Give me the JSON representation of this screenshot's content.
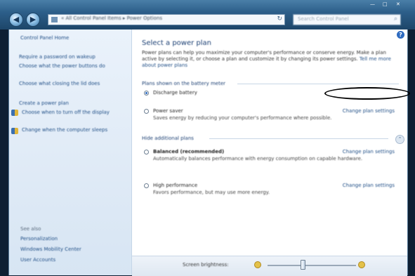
{
  "note": "Screenshot is very low resolution; all text is blurred — strings below are best-effort readings.",
  "address_bar": {
    "path": "« All Control Panel Items ▸ Power Options",
    "search_placeholder": "Search Control Panel"
  },
  "window_controls": {
    "minimize": "—",
    "maximize": "□",
    "close": "✕"
  },
  "sidebar": {
    "home": "Control Panel Home",
    "links": [
      "Require a password on wakeup",
      "Choose what the power buttons do",
      "Choose what closing the lid does",
      "Create a power plan",
      "Choose when to turn off the display",
      "Change when the computer sleeps"
    ],
    "see_also_title": "See also",
    "see_also": [
      "Personalization",
      "Windows Mobility Center",
      "User Accounts"
    ]
  },
  "main": {
    "title": "Select a power plan",
    "description": "Power plans can help you maximize your computer's performance or conserve energy. Make a plan active by selecting it, or choose a plan and customize it by changing its power settings.",
    "description_link": "Tell me more about power plans",
    "battery_group_title": "Plans shown on the battery meter",
    "additional_group_title": "Hide additional plans",
    "change_settings_label": "Change plan settings",
    "plans": [
      {
        "name": "Discharge battery",
        "description": "",
        "selected": true,
        "bold": false
      },
      {
        "name": "Power saver",
        "description": "Saves energy by reducing your computer's performance where possible.",
        "selected": false,
        "bold": false
      },
      {
        "name": "Balanced (recommended)",
        "description": "Automatically balances performance with energy consumption on capable hardware.",
        "selected": false,
        "bold": true
      },
      {
        "name": "High performance",
        "description": "Favors performance, but may use more energy.",
        "selected": false,
        "bold": false
      }
    ]
  },
  "brightness": {
    "label": "Screen brightness:",
    "level_percent": 40
  },
  "colors": {
    "accent": "#2e6bc0",
    "link": "#1f4e86",
    "sidebar_bg": "#dfeaf6"
  }
}
